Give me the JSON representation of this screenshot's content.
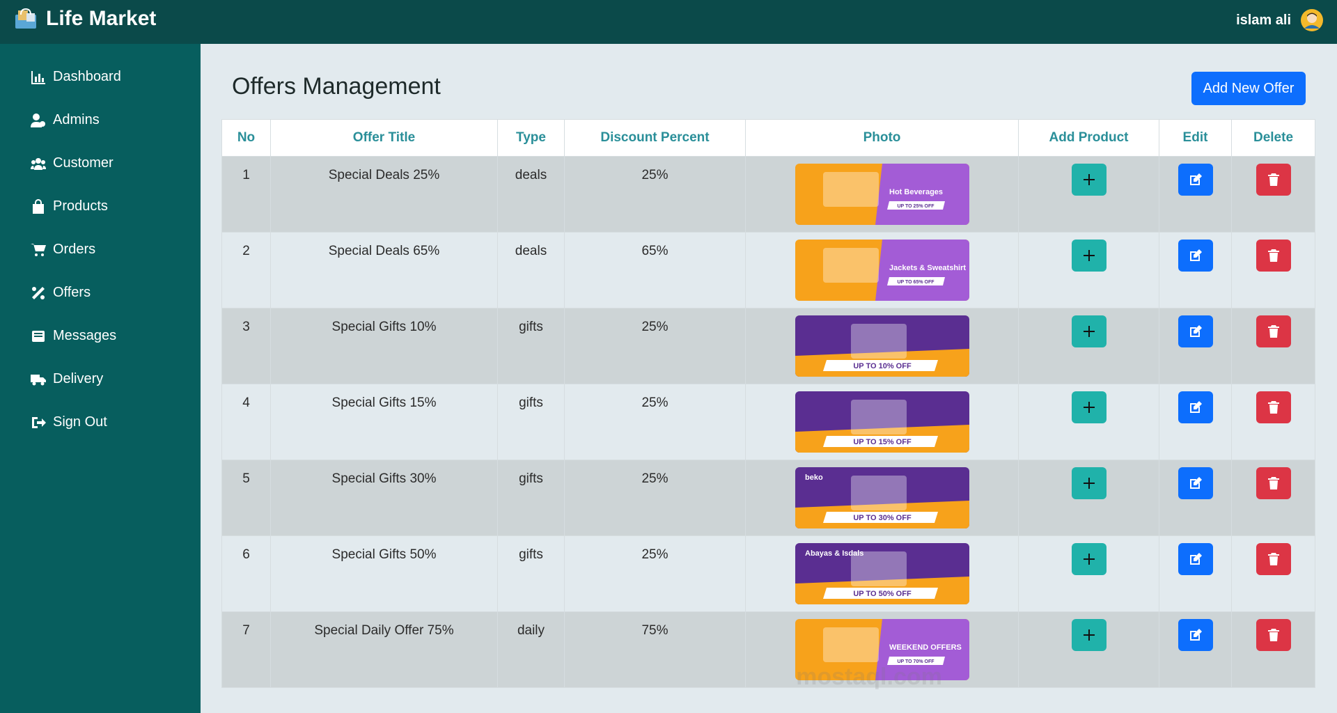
{
  "app": {
    "title": "Life Market"
  },
  "user": {
    "name": "islam ali"
  },
  "sidebar": {
    "items": [
      {
        "label": "Dashboard",
        "icon": "chart-bar-icon"
      },
      {
        "label": "Admins",
        "icon": "user-gear-icon"
      },
      {
        "label": "Customer",
        "icon": "users-icon"
      },
      {
        "label": "Products",
        "icon": "shopping-bag-icon"
      },
      {
        "label": "Orders",
        "icon": "cart-icon"
      },
      {
        "label": "Offers",
        "icon": "percent-icon"
      },
      {
        "label": "Messages",
        "icon": "envelope-icon"
      },
      {
        "label": "Delivery",
        "icon": "truck-icon"
      },
      {
        "label": "Sign Out",
        "icon": "sign-out-icon"
      }
    ]
  },
  "main": {
    "title": "Offers Management",
    "add_button": "Add New Offer",
    "table": {
      "headers": [
        "No",
        "Offer Title",
        "Type",
        "Discount Percent",
        "Photo",
        "Add Product",
        "Edit",
        "Delete"
      ],
      "rows": [
        {
          "no": "1",
          "title": "Special Deals 25%",
          "type": "deals",
          "discount": "25%",
          "photo": {
            "text": "Hot Beverages",
            "badge": "UP TO 25% OFF"
          }
        },
        {
          "no": "2",
          "title": "Special Deals 65%",
          "type": "deals",
          "discount": "65%",
          "photo": {
            "text": "Jackets & Sweatshirt",
            "badge": "UP TO 65% OFF"
          }
        },
        {
          "no": "3",
          "title": "Special Gifts 10%",
          "type": "gifts",
          "discount": "25%",
          "photo": {
            "text": "",
            "badge": "UP TO 10% OFF"
          }
        },
        {
          "no": "4",
          "title": "Special Gifts 15%",
          "type": "gifts",
          "discount": "25%",
          "photo": {
            "text": "",
            "badge": "UP TO 15% OFF"
          }
        },
        {
          "no": "5",
          "title": "Special Gifts 30%",
          "type": "gifts",
          "discount": "25%",
          "photo": {
            "text": "beko",
            "badge": "UP TO 30% OFF"
          }
        },
        {
          "no": "6",
          "title": "Special Gifts 50%",
          "type": "gifts",
          "discount": "25%",
          "photo": {
            "text": "Abayas & Isdals",
            "badge": "UP TO 50% OFF"
          }
        },
        {
          "no": "7",
          "title": "Special Daily Offer 75%",
          "type": "daily",
          "discount": "75%",
          "photo": {
            "text": "WEEKEND OFFERS",
            "badge": "UP TO 70% OFF"
          }
        }
      ]
    }
  },
  "watermark": "mostaql.com",
  "colors": {
    "topbar": "#0b4a4a",
    "sidebar": "#075e5e",
    "content_bg": "#e2eaee",
    "primary": "#0d6efd",
    "teal": "#20b2aa",
    "danger": "#dc3545",
    "header_text": "#2a8f99"
  }
}
